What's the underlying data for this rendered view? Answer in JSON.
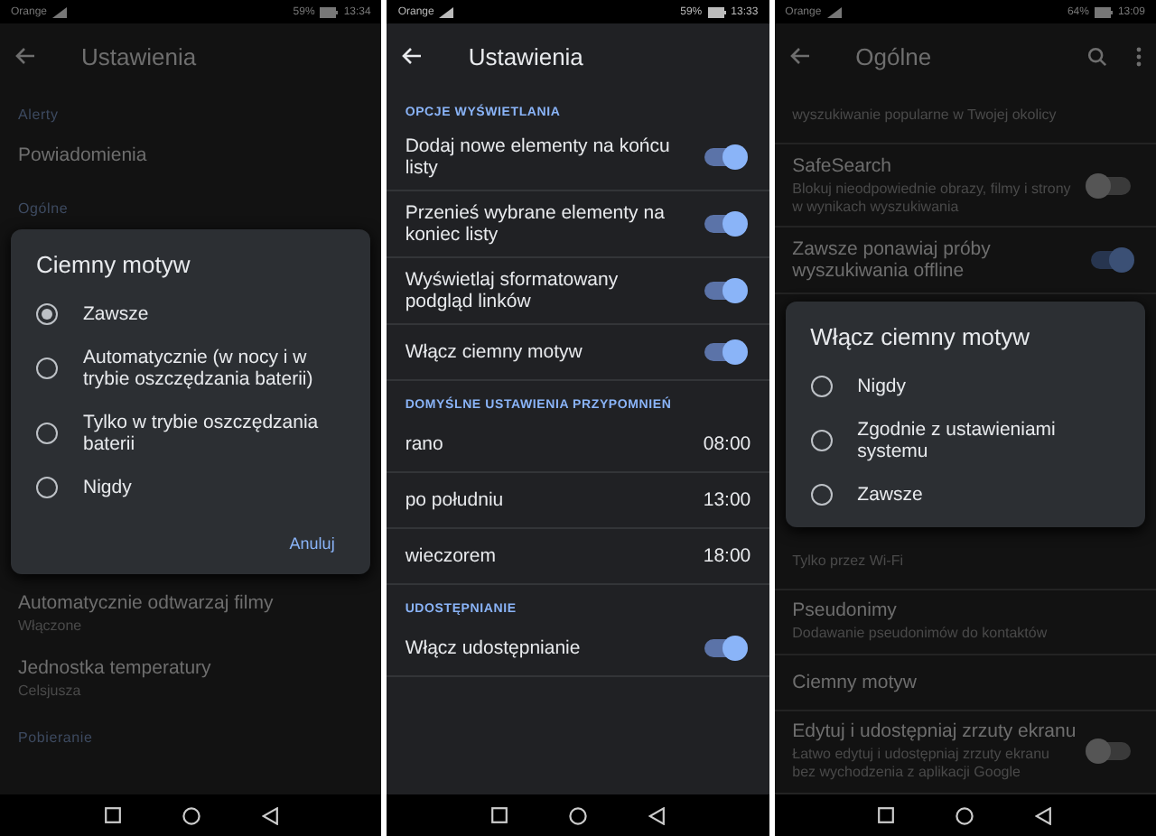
{
  "screens": [
    {
      "dimmed": true,
      "dividers": false,
      "status_bar": {
        "carrier": "Orange",
        "battery": "59%",
        "time": "13:34"
      },
      "header": {
        "title": "Ustawienia"
      },
      "items": [
        {
          "kind": "section",
          "title": "Alerty"
        },
        {
          "kind": "item",
          "title": "Powiadomienia"
        },
        {
          "kind": "section",
          "title": "Ogólne"
        },
        {
          "kind": "dialog",
          "title": "Ciemny motyw",
          "options": [
            {
              "label": "Zawsze",
              "selected": true
            },
            {
              "label": "Automatycznie (w nocy i w trybie oszczędzania baterii)",
              "selected": false
            },
            {
              "label": "Tylko w trybie oszczędzania baterii",
              "selected": false
            },
            {
              "label": "Nigdy",
              "selected": false
            }
          ],
          "buttons": [
            "Anuluj"
          ]
        },
        {
          "kind": "item",
          "title": "Automatycznie odtwarzaj filmy",
          "subtitle": "Włączone"
        },
        {
          "kind": "item",
          "title": "Jednostka temperatury",
          "subtitle": "Celsjusza"
        },
        {
          "kind": "section",
          "title": "Pobieranie"
        }
      ]
    },
    {
      "dimmed": false,
      "dividers": true,
      "status_bar": {
        "carrier": "Orange",
        "battery": "59%",
        "time": "13:33"
      },
      "header": {
        "title": "Ustawienia"
      },
      "items": [
        {
          "kind": "section",
          "title": "OPCJE WYŚWIETLANIA"
        },
        {
          "kind": "toggle",
          "title": "Dodaj nowe elementy na końcu listy",
          "on": true
        },
        {
          "kind": "toggle",
          "title": "Przenieś wybrane elementy na koniec listy",
          "on": true
        },
        {
          "kind": "toggle",
          "title": "Wyświetlaj sformatowany podgląd linków",
          "on": true
        },
        {
          "kind": "toggle",
          "title": "Włącz ciemny motyw",
          "on": true
        },
        {
          "kind": "section",
          "title": "DOMYŚLNE USTAWIENIA PRZYPOMNIEŃ"
        },
        {
          "kind": "value",
          "title": "rano",
          "value": "08:00"
        },
        {
          "kind": "value",
          "title": "po południu",
          "value": "13:00"
        },
        {
          "kind": "value",
          "title": "wieczorem",
          "value": "18:00"
        },
        {
          "kind": "section",
          "title": "UDOSTĘPNIANIE"
        },
        {
          "kind": "toggle",
          "title": "Włącz udostępnianie",
          "on": true
        }
      ]
    },
    {
      "dimmed": true,
      "dividers": true,
      "status_bar": {
        "carrier": "Orange",
        "battery": "64%",
        "time": "13:09"
      },
      "header": {
        "title": "Ogólne",
        "actions": [
          {
            "kind": "search"
          },
          {
            "kind": "more"
          }
        ]
      },
      "items": [
        {
          "kind": "item",
          "subtitle": "wyszukiwanie popularne w Twojej okolicy"
        },
        {
          "kind": "toggle",
          "title": "SafeSearch",
          "subtitle": "Blokuj nieodpowiednie obrazy, filmy i strony w wynikach wyszukiwania",
          "on": false
        },
        {
          "kind": "toggle",
          "title": "Zawsze ponawiaj próby wyszukiwania offline",
          "on": true
        },
        {
          "kind": "dialog",
          "title": "Włącz ciemny motyw",
          "options": [
            {
              "label": "Nigdy",
              "selected": false
            },
            {
              "label": "Zgodnie z ustawieniami systemu",
              "selected": false
            },
            {
              "label": "Zawsze",
              "selected": false
            }
          ]
        },
        {
          "kind": "item",
          "subtitle": "Tylko przez Wi-Fi"
        },
        {
          "kind": "item",
          "title": "Pseudonimy",
          "subtitle": "Dodawanie pseudonimów do kontaktów"
        },
        {
          "kind": "item",
          "title": "Ciemny motyw"
        },
        {
          "kind": "toggle",
          "title": "Edytuj i udostępniaj zrzuty ekranu",
          "subtitle": "Łatwo edytuj i udostępniaj zrzuty ekranu bez wychodzenia z aplikacji Google",
          "on": false
        }
      ]
    }
  ]
}
